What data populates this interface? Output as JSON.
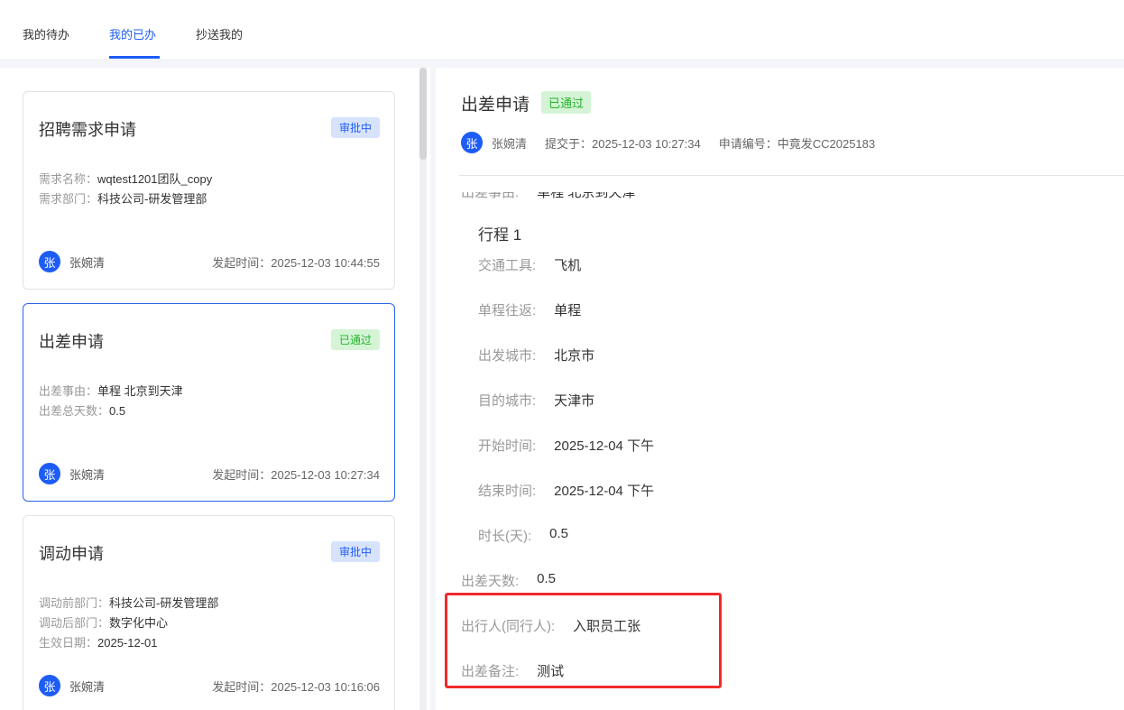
{
  "tabs": [
    {
      "label": "我的待办"
    },
    {
      "label": "我的已办"
    },
    {
      "label": "抄送我的"
    }
  ],
  "cards": [
    {
      "title": "招聘需求申请",
      "status": "审批中",
      "fields": [
        {
          "label": "需求名称：",
          "value": "wqtest1201团队_copy"
        },
        {
          "label": "需求部门：",
          "value": "科技公司-研发管理部"
        }
      ],
      "avatar": "张",
      "user": "张婉清",
      "time": "发起时间：2025-12-03 10:44:55"
    },
    {
      "title": "出差申请",
      "status": "已通过",
      "fields": [
        {
          "label": "出差事由：",
          "value": "单程 北京到天津"
        },
        {
          "label": "出差总天数：",
          "value": "0.5"
        }
      ],
      "avatar": "张",
      "user": "张婉清",
      "time": "发起时间：2025-12-03 10:27:34"
    },
    {
      "title": "调动申请",
      "status": "审批中",
      "fields": [
        {
          "label": "调动前部门：",
          "value": "科技公司-研发管理部"
        },
        {
          "label": "调动后部门：",
          "value": "数字化中心"
        },
        {
          "label": "生效日期：",
          "value": "2025-12-01"
        }
      ],
      "avatar": "张",
      "user": "张婉清",
      "time": "发起时间：2025-12-03 10:16:06"
    }
  ],
  "detail": {
    "title": "出差申请",
    "status": "已通过",
    "avatar": "张",
    "user": "张婉清",
    "submitted": "提交于：2025-12-03 10:27:34",
    "number": "申请编号：中竟发CC2025183",
    "reason": {
      "label": "出差事由:",
      "value": "单程 北京到天津"
    },
    "trip_title": "行程 1",
    "trip_fields": [
      {
        "label": "交通工具:",
        "value": "飞机"
      },
      {
        "label": "单程往返:",
        "value": "单程"
      },
      {
        "label": "出发城市:",
        "value": "北京市"
      },
      {
        "label": "目的城市:",
        "value": "天津市"
      },
      {
        "label": "开始时间:",
        "value": "2025-12-04 下午"
      },
      {
        "label": "结束时间:",
        "value": "2025-12-04 下午"
      },
      {
        "label": "时长(天):",
        "value": "0.5"
      }
    ],
    "days": {
      "label": "出差天数:",
      "value": "0.5"
    },
    "traveler": {
      "label": "出行人(同行人):",
      "value": "入职员工张"
    },
    "remark": {
      "label": "出差备注:",
      "value": "测试"
    }
  },
  "colors": {
    "accent": "#1d5cf5",
    "success": "#22b32a",
    "highlight": "#ef2b2b"
  }
}
